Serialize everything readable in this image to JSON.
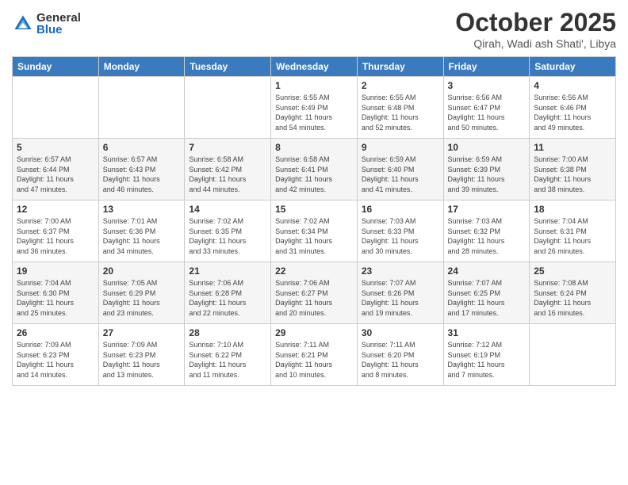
{
  "logo": {
    "general": "General",
    "blue": "Blue"
  },
  "header": {
    "month": "October 2025",
    "location": "Qirah, Wadi ash Shati', Libya"
  },
  "days_of_week": [
    "Sunday",
    "Monday",
    "Tuesday",
    "Wednesday",
    "Thursday",
    "Friday",
    "Saturday"
  ],
  "weeks": [
    [
      {
        "day": "",
        "info": ""
      },
      {
        "day": "",
        "info": ""
      },
      {
        "day": "",
        "info": ""
      },
      {
        "day": "1",
        "info": "Sunrise: 6:55 AM\nSunset: 6:49 PM\nDaylight: 11 hours\nand 54 minutes."
      },
      {
        "day": "2",
        "info": "Sunrise: 6:55 AM\nSunset: 6:48 PM\nDaylight: 11 hours\nand 52 minutes."
      },
      {
        "day": "3",
        "info": "Sunrise: 6:56 AM\nSunset: 6:47 PM\nDaylight: 11 hours\nand 50 minutes."
      },
      {
        "day": "4",
        "info": "Sunrise: 6:56 AM\nSunset: 6:46 PM\nDaylight: 11 hours\nand 49 minutes."
      }
    ],
    [
      {
        "day": "5",
        "info": "Sunrise: 6:57 AM\nSunset: 6:44 PM\nDaylight: 11 hours\nand 47 minutes."
      },
      {
        "day": "6",
        "info": "Sunrise: 6:57 AM\nSunset: 6:43 PM\nDaylight: 11 hours\nand 46 minutes."
      },
      {
        "day": "7",
        "info": "Sunrise: 6:58 AM\nSunset: 6:42 PM\nDaylight: 11 hours\nand 44 minutes."
      },
      {
        "day": "8",
        "info": "Sunrise: 6:58 AM\nSunset: 6:41 PM\nDaylight: 11 hours\nand 42 minutes."
      },
      {
        "day": "9",
        "info": "Sunrise: 6:59 AM\nSunset: 6:40 PM\nDaylight: 11 hours\nand 41 minutes."
      },
      {
        "day": "10",
        "info": "Sunrise: 6:59 AM\nSunset: 6:39 PM\nDaylight: 11 hours\nand 39 minutes."
      },
      {
        "day": "11",
        "info": "Sunrise: 7:00 AM\nSunset: 6:38 PM\nDaylight: 11 hours\nand 38 minutes."
      }
    ],
    [
      {
        "day": "12",
        "info": "Sunrise: 7:00 AM\nSunset: 6:37 PM\nDaylight: 11 hours\nand 36 minutes."
      },
      {
        "day": "13",
        "info": "Sunrise: 7:01 AM\nSunset: 6:36 PM\nDaylight: 11 hours\nand 34 minutes."
      },
      {
        "day": "14",
        "info": "Sunrise: 7:02 AM\nSunset: 6:35 PM\nDaylight: 11 hours\nand 33 minutes."
      },
      {
        "day": "15",
        "info": "Sunrise: 7:02 AM\nSunset: 6:34 PM\nDaylight: 11 hours\nand 31 minutes."
      },
      {
        "day": "16",
        "info": "Sunrise: 7:03 AM\nSunset: 6:33 PM\nDaylight: 11 hours\nand 30 minutes."
      },
      {
        "day": "17",
        "info": "Sunrise: 7:03 AM\nSunset: 6:32 PM\nDaylight: 11 hours\nand 28 minutes."
      },
      {
        "day": "18",
        "info": "Sunrise: 7:04 AM\nSunset: 6:31 PM\nDaylight: 11 hours\nand 26 minutes."
      }
    ],
    [
      {
        "day": "19",
        "info": "Sunrise: 7:04 AM\nSunset: 6:30 PM\nDaylight: 11 hours\nand 25 minutes."
      },
      {
        "day": "20",
        "info": "Sunrise: 7:05 AM\nSunset: 6:29 PM\nDaylight: 11 hours\nand 23 minutes."
      },
      {
        "day": "21",
        "info": "Sunrise: 7:06 AM\nSunset: 6:28 PM\nDaylight: 11 hours\nand 22 minutes."
      },
      {
        "day": "22",
        "info": "Sunrise: 7:06 AM\nSunset: 6:27 PM\nDaylight: 11 hours\nand 20 minutes."
      },
      {
        "day": "23",
        "info": "Sunrise: 7:07 AM\nSunset: 6:26 PM\nDaylight: 11 hours\nand 19 minutes."
      },
      {
        "day": "24",
        "info": "Sunrise: 7:07 AM\nSunset: 6:25 PM\nDaylight: 11 hours\nand 17 minutes."
      },
      {
        "day": "25",
        "info": "Sunrise: 7:08 AM\nSunset: 6:24 PM\nDaylight: 11 hours\nand 16 minutes."
      }
    ],
    [
      {
        "day": "26",
        "info": "Sunrise: 7:09 AM\nSunset: 6:23 PM\nDaylight: 11 hours\nand 14 minutes."
      },
      {
        "day": "27",
        "info": "Sunrise: 7:09 AM\nSunset: 6:23 PM\nDaylight: 11 hours\nand 13 minutes."
      },
      {
        "day": "28",
        "info": "Sunrise: 7:10 AM\nSunset: 6:22 PM\nDaylight: 11 hours\nand 11 minutes."
      },
      {
        "day": "29",
        "info": "Sunrise: 7:11 AM\nSunset: 6:21 PM\nDaylight: 11 hours\nand 10 minutes."
      },
      {
        "day": "30",
        "info": "Sunrise: 7:11 AM\nSunset: 6:20 PM\nDaylight: 11 hours\nand 8 minutes."
      },
      {
        "day": "31",
        "info": "Sunrise: 7:12 AM\nSunset: 6:19 PM\nDaylight: 11 hours\nand 7 minutes."
      },
      {
        "day": "",
        "info": ""
      }
    ]
  ]
}
